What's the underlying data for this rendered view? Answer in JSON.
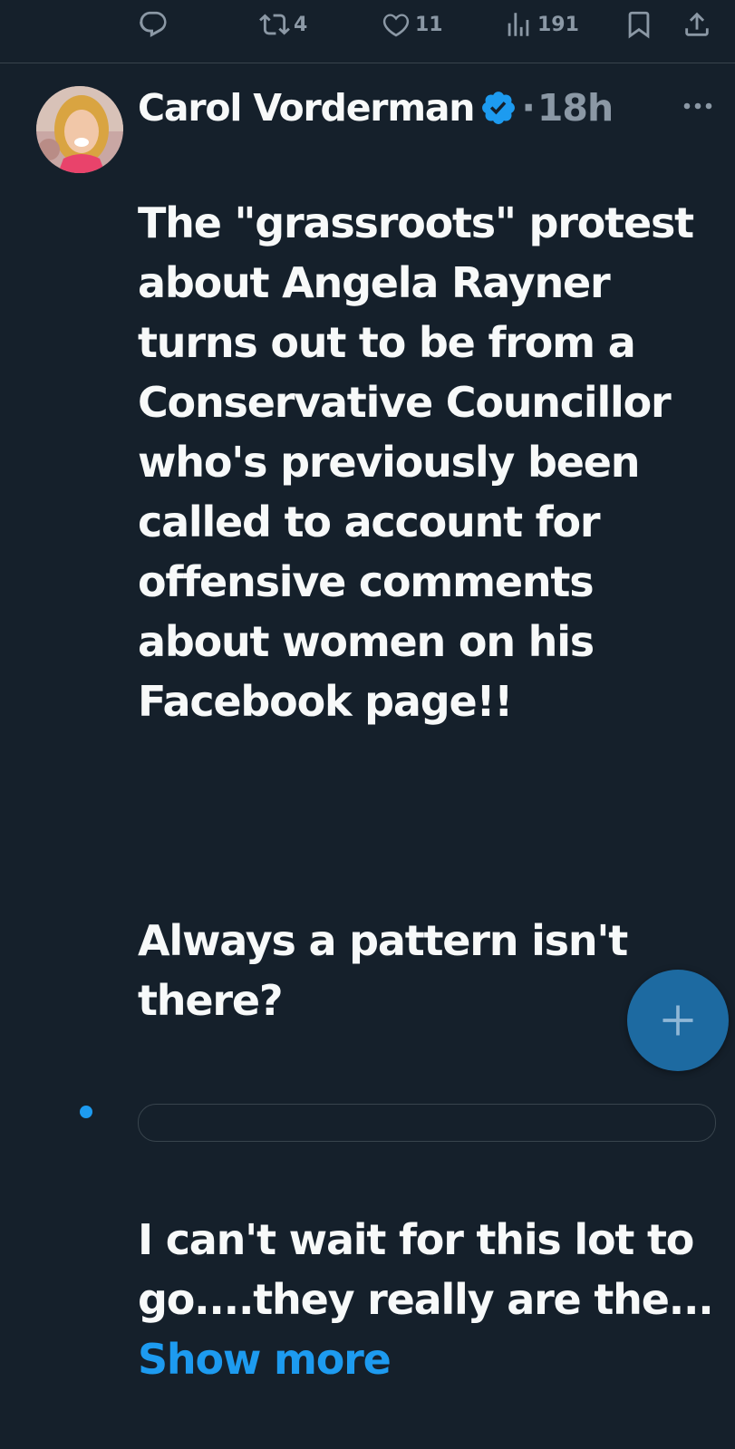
{
  "actions": {
    "reply_count": "",
    "retweet_count": "4",
    "like_count": "11",
    "view_count": "191"
  },
  "tweet": {
    "author_name": "Carol Vorderman",
    "separator": "·",
    "time": "18h",
    "paragraphs": [
      "The \"grassroots\" protest about Angela Rayner turns out to be from a Conservative Councillor who's previously been called to account for offensive comments about women on his Facebook page!!",
      "Always a pattern isn't there?"
    ],
    "truncated_text": "I can't wait for this lot to go....they really are the...",
    "show_more_label": "Show more"
  },
  "colors": {
    "background": "#15202b",
    "text": "#f7f9f9",
    "muted": "#8b98a5",
    "accent": "#1d9bf0",
    "fab": "#1d6aa1"
  },
  "icons": [
    "reply-icon",
    "retweet-icon",
    "like-icon",
    "views-icon",
    "bookmark-icon",
    "share-icon",
    "verified-badge-icon",
    "more-options-icon",
    "compose-plus-icon"
  ]
}
